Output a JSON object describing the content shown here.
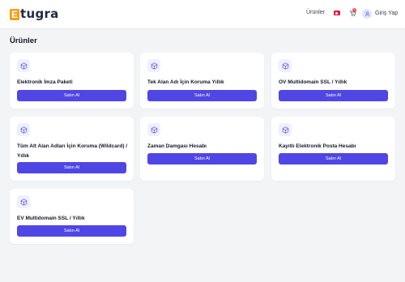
{
  "header": {
    "logo_letter": "E",
    "logo_text": "tugra",
    "nav_products": "Ürünler",
    "cart_count": "0",
    "login": "Giriş Yap"
  },
  "main": {
    "title": "Ürünler",
    "products": [
      {
        "name": "Elektronik İmza Paketi",
        "button": "Satın Al"
      },
      {
        "name": "Tek Alan Adı İçin Koruma Yıllık",
        "button": "Satın Al"
      },
      {
        "name": "OV Multidomain SSL / Yıllık",
        "button": "Satın Al"
      },
      {
        "name": "Tüm Alt Alan Adları İçin Koruma (Wildcard) / Yıllık",
        "button": "Satın Al"
      },
      {
        "name": "Zaman Damgası Hesabı",
        "button": "Satın Al"
      },
      {
        "name": "Kayıtlı Elektronik Posta Hesabı",
        "button": "Satın Al"
      },
      {
        "name": "EV Multidomain SSL / Yıllık",
        "button": "Satın Al"
      }
    ]
  },
  "colors": {
    "accent": "#4f46e5",
    "icon_bg": "#eef0ff",
    "page_bg": "#f3f4f6",
    "logo": "#f59e0b"
  },
  "icons": {
    "product": "cube-icon",
    "cart": "cart-icon",
    "user": "user-icon",
    "flag": "turkey-flag-icon"
  }
}
